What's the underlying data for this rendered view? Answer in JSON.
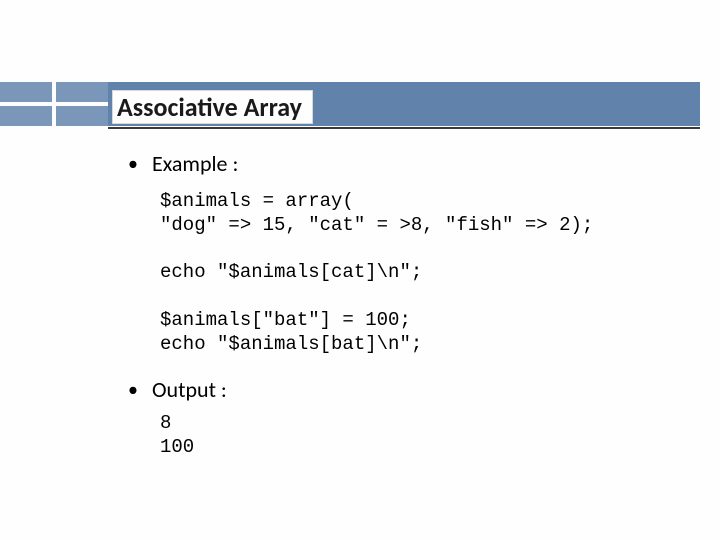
{
  "title": "Associative Array",
  "sections": [
    {
      "label": "Example :",
      "code": "$animals = array(\n\"dog\" => 15, \"cat\" = >8, \"fish\" => 2);\n\necho \"$animals[cat]\\n\";\n\n$animals[\"bat\"] = 100;\necho \"$animals[bat]\\n\";"
    },
    {
      "label": "Output :",
      "code": "8\n100"
    }
  ]
}
